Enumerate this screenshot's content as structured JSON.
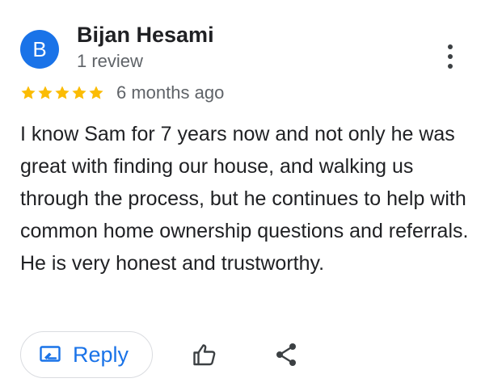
{
  "author": {
    "initial": "B",
    "name": "Bijan Hesami",
    "review_count": "1 review"
  },
  "rating": {
    "stars": 5,
    "max_stars": 5,
    "age": "6 months ago"
  },
  "review": {
    "text": "I know Sam for 7 years now and not only he was great with finding our house, and walking us through the process, but he continues to help with common home ownership questions and referrals. He is very honest and trustworthy."
  },
  "actions": {
    "reply_label": "Reply",
    "reply_icon": "reply-icon",
    "like_icon": "thumbs-up-icon",
    "share_icon": "share-icon",
    "menu_icon": "more-vert-icon"
  },
  "colors": {
    "avatar_bg": "#1a73e8",
    "star": "#fbbc04",
    "accent": "#1a73e8",
    "secondary_text": "#5f6368"
  }
}
